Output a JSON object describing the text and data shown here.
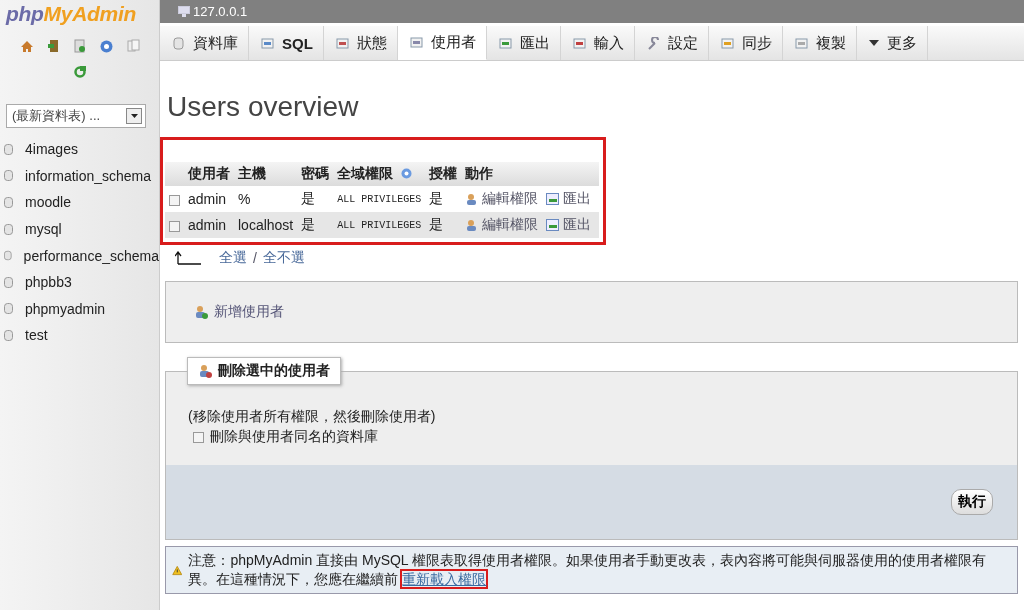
{
  "sidebar": {
    "logo": {
      "part_1": "php",
      "part_2": "MyAdmin"
    },
    "table_select": {
      "value": "(最新資料表) ..."
    },
    "databases": [
      "4images",
      "information_schema",
      "moodle",
      "mysql",
      "performance_schema",
      "phpbb3",
      "phpmyadmin",
      "test"
    ]
  },
  "breadcrumb": "127.0.0.1",
  "tabs": [
    {
      "label": "資料庫",
      "selected": false
    },
    {
      "label": "SQL",
      "selected": false
    },
    {
      "label": "狀態",
      "selected": false
    },
    {
      "label": "使用者",
      "selected": true
    },
    {
      "label": "匯出",
      "selected": false
    },
    {
      "label": "輸入",
      "selected": false
    },
    {
      "label": "設定",
      "selected": false
    },
    {
      "label": "同步",
      "selected": false
    },
    {
      "label": "複製",
      "selected": false
    },
    {
      "label": "更多",
      "selected": false
    }
  ],
  "heading": "Users overview",
  "users_table": {
    "highlighted": true,
    "columns": [
      "使用者",
      "主機",
      "密碼",
      "全域權限",
      "授權",
      "動作"
    ],
    "rows": [
      {
        "checked": false,
        "user": "admin",
        "host": "%",
        "password": "是",
        "privileges": "ALL PRIVILEGES",
        "grant": "是",
        "edit": "編輯權限",
        "export": "匯出"
      },
      {
        "checked": false,
        "user": "admin",
        "host": "localhost",
        "password": "是",
        "privileges": "ALL PRIVILEGES",
        "grant": "是",
        "edit": "編輯權限",
        "export": "匯出"
      }
    ]
  },
  "check_all": {
    "select_all": "全選",
    "separator": "/",
    "deselect_all": "全不選"
  },
  "add_user": "新增使用者",
  "delete_users": {
    "legend": "刪除選中的使用者",
    "note": "(移除使用者所有權限，然後刪除使用者)",
    "drop_db": {
      "label": "刪除與使用者同名的資料庫",
      "checked": false
    },
    "submit": "執行"
  },
  "notice": {
    "text": "注意：phpMyAdmin 直接由 MySQL 權限表取得使用者權限。如果使用者手動更改表，表內容將可能與伺服器使用的使用者權限有異。在這種情況下，您應在繼續前",
    "link": "重新載入權限",
    "link_highlighted": true
  }
}
